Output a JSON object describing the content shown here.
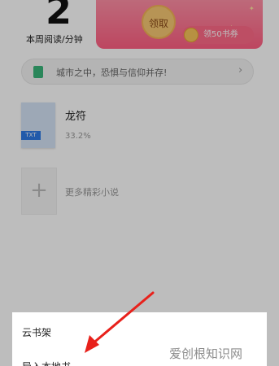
{
  "reading_stats": {
    "weekly_minutes": "2",
    "label": "本周阅读/分钟"
  },
  "reward_banner": {
    "claim_label": "领取",
    "coupon_label": "领50书券"
  },
  "promo": {
    "text": "城市之中，恐惧与信仰并存!",
    "chevron": "›"
  },
  "bookshelf": {
    "books": [
      {
        "title": "龙符",
        "progress": "33.2%",
        "format_tag": "TXT"
      }
    ],
    "more_label": "更多精彩小说",
    "more_icon": "+"
  },
  "bottom_sheet": {
    "items": [
      {
        "label": "云书架"
      },
      {
        "label": "导入本地书"
      }
    ]
  },
  "watermark": "爱创根知识网",
  "colors": {
    "red_packet": "#ff6a88",
    "gold": "#f7c873",
    "promo_icon": "#39b57a",
    "txt_tag": "#2d7ae6",
    "arrow": "#e8211b",
    "overlay": "rgba(0,0,0,0.26)"
  },
  "icons": {
    "promo": "book-icon",
    "coupon": "coin-icon",
    "chevron": "chevron-right-icon",
    "add": "plus-icon"
  }
}
